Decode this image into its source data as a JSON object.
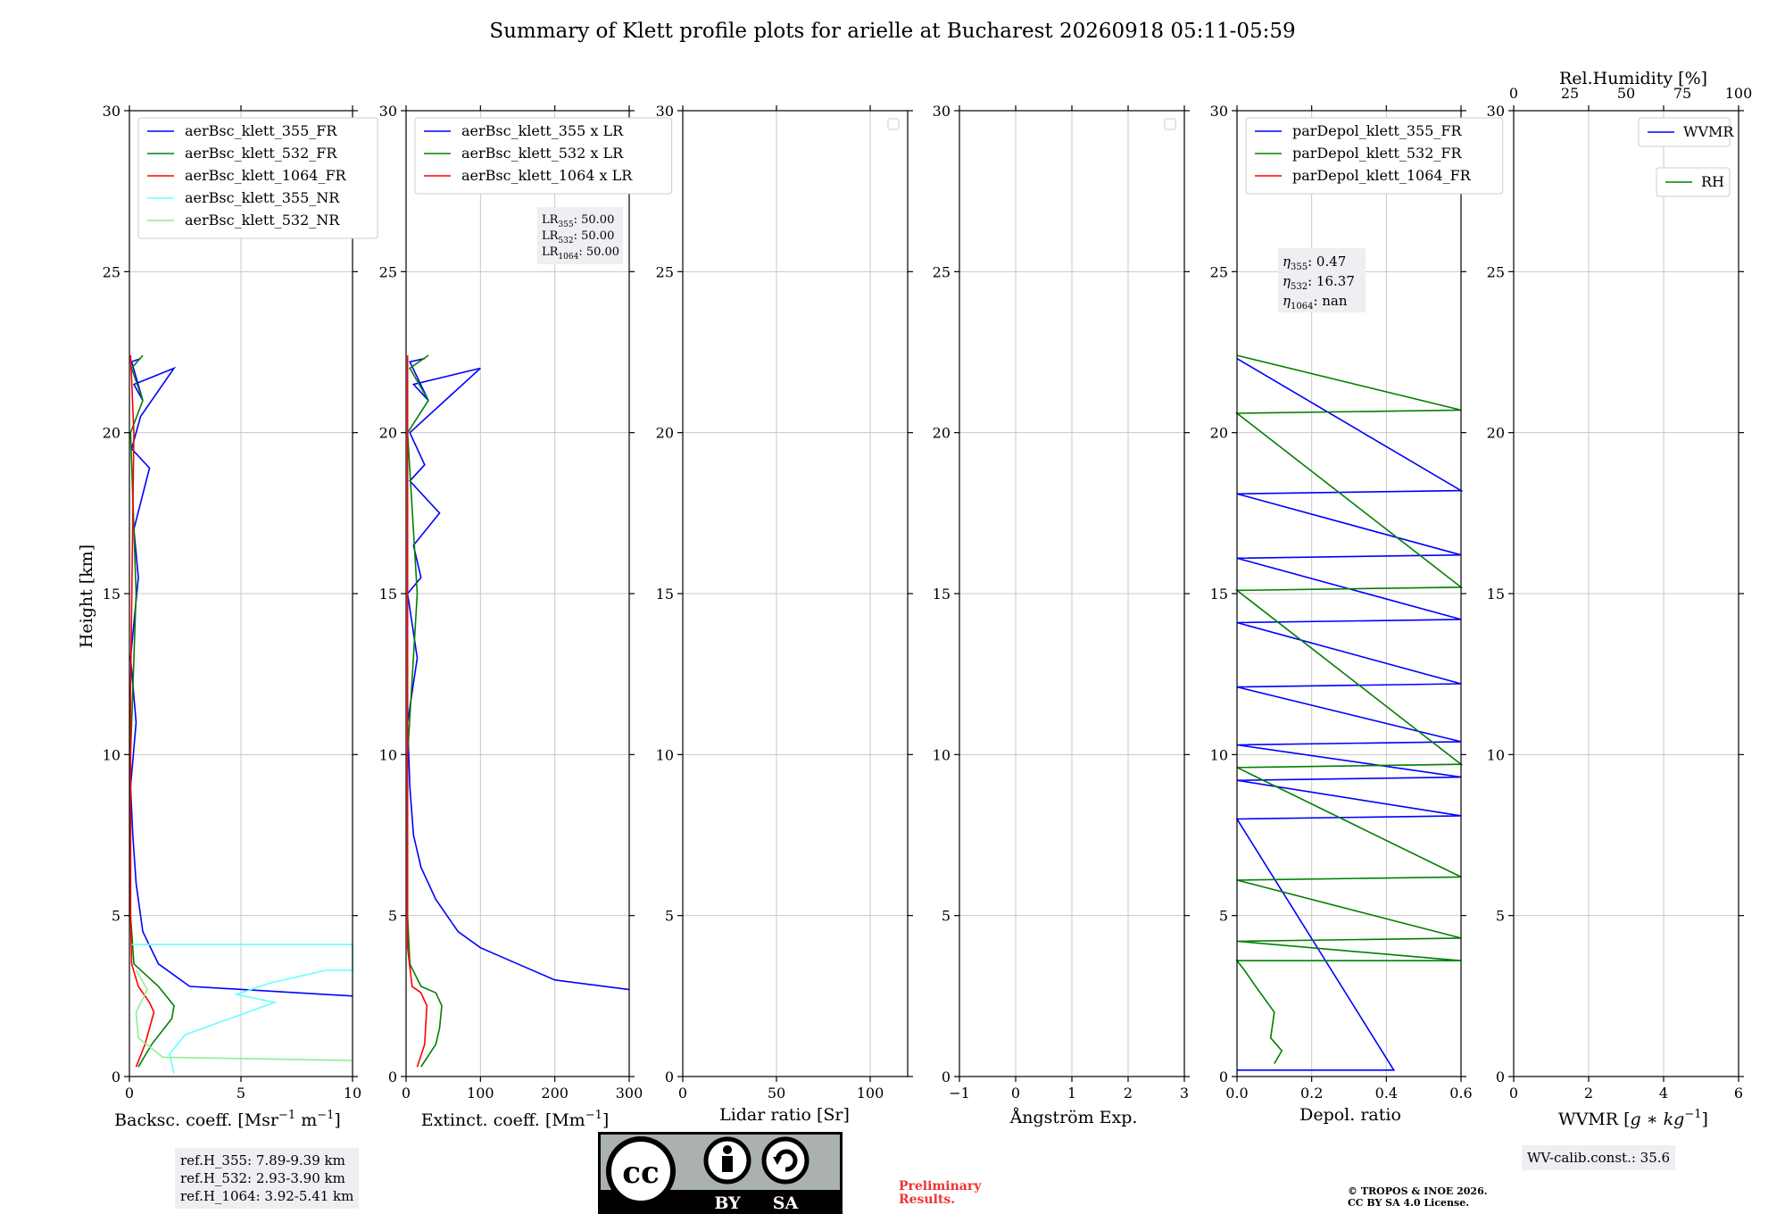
{
  "figure_title": "Summary of Klett profile plots for arielle at Bucharest 20260918 05:11-05:59",
  "colors": {
    "blue": "#0000ff",
    "green": "#008000",
    "red": "#ff0000",
    "cyan": "#66ffff",
    "lightgreen": "#90ee90",
    "grid": "#c8c8c8"
  },
  "chart_data": [
    {
      "type": "line",
      "panel": "backscatter",
      "xlabel": "Backsc. coeff. [Msr$^{-1}$ m$^{-1}$]",
      "xlabel_main": "Backsc. coeff. [Msr",
      "xlabel_sup1": "−1",
      "xlabel_mid": " m",
      "xlabel_sup2": "−1",
      "xlabel_end": "]",
      "ylabel": "Height [km]",
      "xlim": [
        0,
        10
      ],
      "ylim": [
        0,
        30
      ],
      "xticks": [
        "0",
        "5",
        "10"
      ],
      "yticks": [
        "0",
        "5",
        "10",
        "15",
        "20",
        "25",
        "30"
      ],
      "legend": "top-left",
      "series": [
        {
          "name": "aerBsc_klett_355_FR",
          "color": "#0000ff",
          "x": [
            10,
            2.7,
            1.3,
            0.6,
            0.3,
            0.15,
            0.05,
            0.3,
            0.05,
            0.4,
            0.2,
            0.9,
            0.1,
            0.5,
            2,
            0.2,
            0.6,
            0.1,
            0.5
          ],
          "y": [
            2.5,
            2.8,
            3.5,
            4.5,
            6.0,
            7.5,
            9,
            11,
            13,
            15.5,
            17,
            18.9,
            19.5,
            20.5,
            22.0,
            21.5,
            21,
            22.2,
            22.3
          ]
        },
        {
          "name": "aerBsc_klett_532_FR",
          "color": "#008000",
          "x": [
            0.4,
            1.0,
            1.9,
            2.0,
            1.3,
            0.2,
            0.05,
            0.05,
            0.3,
            0.05,
            0.6,
            0.1,
            0.6
          ],
          "y": [
            0.3,
            1.0,
            1.8,
            2.2,
            2.8,
            3.5,
            5.0,
            10.0,
            15.0,
            20.0,
            21.0,
            22.0,
            22.4
          ]
        },
        {
          "name": "aerBsc_klett_1064_FR",
          "color": "#ff0000",
          "x": [
            0.3,
            0.7,
            1.1,
            0.9,
            0.4,
            0.1,
            0.05,
            0.05,
            0.2,
            0.05
          ],
          "y": [
            0.3,
            1.0,
            2.0,
            2.3,
            2.8,
            3.5,
            5.0,
            12.0,
            20.0,
            22.4
          ]
        },
        {
          "name": "aerBsc_klett_355_NR",
          "color": "#66ffff",
          "x": [
            2,
            1.8,
            2.5,
            4.5,
            6.5,
            4.8,
            6.3,
            8.8,
            10,
            10,
            0.1
          ],
          "y": [
            0.1,
            0.7,
            1.3,
            1.8,
            2.3,
            2.55,
            2.9,
            3.3,
            3.3,
            4.1,
            4.1
          ]
        },
        {
          "name": "aerBsc_klett_532_NR",
          "color": "#90ee90",
          "x": [
            10,
            1.5,
            0.4,
            0.3,
            0.8,
            0.3
          ],
          "y": [
            0.5,
            0.6,
            1.2,
            2.0,
            2.7,
            3.3
          ]
        }
      ],
      "info": [
        "ref.H_355: 7.89-9.39 km",
        "ref.H_532: 2.93-3.90 km",
        "ref.H_1064: 3.92-5.41 km"
      ]
    },
    {
      "type": "line",
      "panel": "extinction",
      "xlabel_main": "Extinct. coeff. [Mm",
      "xlabel_sup": "−1",
      "xlabel_end": "]",
      "xlim": [
        0,
        300
      ],
      "ylim": [
        0,
        30
      ],
      "xticks": [
        "0",
        "100",
        "200",
        "300"
      ],
      "yticks": [
        "0",
        "5",
        "10",
        "15",
        "20",
        "25",
        "30"
      ],
      "legend": "top-left",
      "series": [
        {
          "name": "aerBsc_klett_355 x LR",
          "color": "#0000ff",
          "x": [
            300,
            200,
            150,
            100,
            70,
            40,
            20,
            10,
            5,
            2,
            15,
            2,
            20,
            10,
            45,
            5,
            25,
            5,
            100,
            10,
            30,
            5,
            25
          ],
          "y": [
            2.7,
            3.0,
            3.5,
            4.0,
            4.5,
            5.5,
            6.5,
            7.5,
            9,
            11,
            13,
            15,
            15.5,
            16.5,
            17.5,
            18.5,
            19,
            20,
            22.0,
            21.5,
            21,
            22.2,
            22.3
          ]
        },
        {
          "name": "aerBsc_klett_532 x LR",
          "color": "#008000",
          "x": [
            20,
            40,
            45,
            48,
            40,
            20,
            5,
            2,
            2,
            15,
            2,
            30,
            5,
            30
          ],
          "y": [
            0.3,
            1.0,
            1.5,
            2.2,
            2.6,
            2.8,
            3.5,
            5,
            10,
            15,
            20,
            21,
            22,
            22.4
          ]
        },
        {
          "name": "aerBsc_klett_1064 x LR",
          "color": "#ff0000",
          "x": [
            15,
            25,
            28,
            20,
            8,
            2,
            2,
            2
          ],
          "y": [
            0.3,
            1.0,
            2.2,
            2.6,
            2.8,
            4,
            12,
            22.4
          ]
        }
      ],
      "info": [
        {
          "sym": "LR",
          "sub": "355",
          "val": ": 50.00"
        },
        {
          "sym": "LR",
          "sub": "532",
          "val": ": 50.00"
        },
        {
          "sym": "LR",
          "sub": "1064",
          "val": ": 50.00"
        }
      ]
    },
    {
      "type": "line",
      "panel": "lidar-ratio",
      "xlabel": "Lidar ratio [Sr]",
      "xlim": [
        0,
        120
      ],
      "ylim": [
        0,
        30
      ],
      "xticks": [
        "0",
        "50",
        "100"
      ],
      "yticks": [
        "0",
        "5",
        "10",
        "15",
        "20",
        "25",
        "30"
      ],
      "legend": "top-right",
      "series": []
    },
    {
      "type": "line",
      "panel": "angstrom",
      "xlabel": "Ångström Exp.",
      "xlim": [
        -1,
        3
      ],
      "ylim": [
        0,
        30
      ],
      "xticks": [
        "−1",
        "0",
        "1",
        "2",
        "3"
      ],
      "yticks": [
        "0",
        "5",
        "10",
        "15",
        "20",
        "25",
        "30"
      ],
      "legend": "top-right",
      "series": []
    },
    {
      "type": "line",
      "panel": "depolarization",
      "xlabel": "Depol. ratio",
      "xlim": [
        0,
        0.6
      ],
      "ylim": [
        0,
        30
      ],
      "xticks": [
        "0.0",
        "0.2",
        "0.4",
        "0.6"
      ],
      "yticks": [
        "0",
        "5",
        "10",
        "15",
        "20",
        "25",
        "30"
      ],
      "legend": "top-left",
      "series": [
        {
          "name": "parDepol_klett_355_FR",
          "color": "#0000ff",
          "x": [
            0.0,
            0.42,
            0.0,
            0.6,
            0.0,
            0.6,
            0.0,
            0.6,
            0.0,
            0.6,
            0.0,
            0.6,
            0.0,
            0.6,
            0.0,
            0.6,
            0.0
          ],
          "y": [
            0.2,
            0.2,
            8,
            8.1,
            9.2,
            9.3,
            10.3,
            10.4,
            12.1,
            12.2,
            14.1,
            14.2,
            16.1,
            16.2,
            18.1,
            18.2,
            22.3
          ]
        },
        {
          "name": "parDepol_klett_532_FR",
          "color": "#008000",
          "x": [
            0.1,
            0.12,
            0.09,
            0.1,
            0.05,
            0.02,
            0.0,
            0.6,
            0.0,
            0.6,
            0.0,
            0.6,
            0.0,
            0.6,
            0.0,
            0.6,
            0.0,
            0.6,
            0.0
          ],
          "y": [
            0.4,
            0.8,
            1.2,
            2.0,
            2.8,
            3.3,
            3.6,
            3.6,
            4.2,
            4.3,
            6.1,
            6.2,
            9.6,
            9.7,
            15.1,
            15.2,
            20.6,
            20.7,
            22.4
          ]
        },
        {
          "name": "parDepol_klett_1064_FR",
          "color": "#ff0000",
          "x": [],
          "y": []
        }
      ],
      "info": [
        {
          "sym": "η",
          "sub": "355",
          "val": ": 0.47"
        },
        {
          "sym": "η",
          "sub": "532",
          "val": ": 16.37"
        },
        {
          "sym": "η",
          "sub": "1064",
          "val": ": nan"
        }
      ]
    },
    {
      "type": "line",
      "panel": "water-vapor",
      "xlabel_main": "WVMR [",
      "xlabel_italic": "g ∗ kg",
      "xlabel_sup": "−1",
      "xlabel_end": "]",
      "xlim": [
        0,
        6
      ],
      "ylim": [
        0,
        30
      ],
      "xticks": [
        "0",
        "2",
        "4",
        "6"
      ],
      "yticks": [
        "0",
        "5",
        "10",
        "15",
        "20",
        "25",
        "30"
      ],
      "top_xlabel": "Rel.Humidity [%]",
      "top_xlim": [
        0,
        100
      ],
      "top_xticks": [
        "0",
        "25",
        "50",
        "75",
        "100"
      ],
      "legend": "top-right",
      "series": [
        {
          "name": "WVMR",
          "color": "#0000ff",
          "x": [],
          "y": []
        },
        {
          "name": "RH",
          "color": "#008000",
          "x": [],
          "y": []
        }
      ],
      "info": [
        "WV-calib.const.: 35.6"
      ]
    }
  ],
  "license_badge": {
    "cc": "cc",
    "by": "BY",
    "sa": "SA"
  },
  "preliminary": [
    "Preliminary",
    "Results."
  ],
  "copyright": [
    "© TROPOS & INOE 2026.",
    "CC BY SA 4.0 License."
  ]
}
